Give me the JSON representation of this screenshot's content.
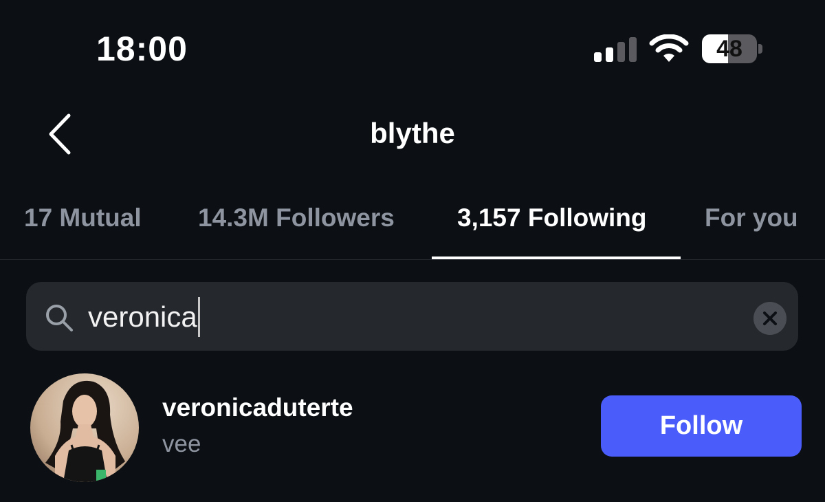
{
  "status_bar": {
    "time": "18:00",
    "signal_icon": "cellular-signal-icon",
    "wifi_icon": "wifi-icon",
    "battery_level": "48",
    "battery_fraction": 0.48
  },
  "header": {
    "back_icon": "chevron-left-icon",
    "title": "blythe"
  },
  "tabs": [
    {
      "label": "17 Mutual",
      "active": false
    },
    {
      "label": "14.3M Followers",
      "active": false
    },
    {
      "label": "3,157 Following",
      "active": true
    },
    {
      "label": "For you",
      "active": false
    }
  ],
  "search": {
    "icon": "search-icon",
    "value": "veronica",
    "clear_icon": "clear-x-icon"
  },
  "results": [
    {
      "username": "veronicaduterte",
      "full_name": "vee",
      "button_label": "Follow"
    }
  ],
  "colors": {
    "background": "#0c1014",
    "accent": "#4a5dfa",
    "muted_text": "#8e95a0",
    "search_bg": "#25282d"
  }
}
